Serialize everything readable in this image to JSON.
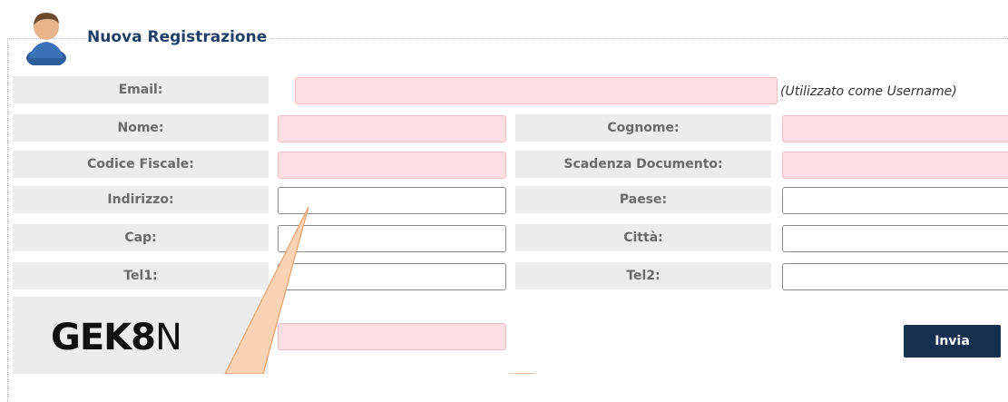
{
  "header": {
    "title": "Nuova Registrazione"
  },
  "form": {
    "email_label": "Email:",
    "email_note": "(Utilizzato come Username)",
    "nome_label": "Nome:",
    "cognome_label": "Cognome:",
    "codice_fiscale_label": "Codice Fiscale:",
    "scadenza_documento_label": "Scadenza Documento:",
    "indirizzo_label": "Indirizzo:",
    "paese_label": "Paese:",
    "cap_label": "Cap:",
    "citta_label": "Città:",
    "tel1_label": "Tel1:",
    "tel2_label": "Tel2:",
    "captcha_text_main": "GEK8",
    "captcha_text_last": "N",
    "submit_label": "Invia"
  },
  "colors": {
    "required_fill": "#fddfe3",
    "label_background": "#ececec",
    "button": "#17304f",
    "title": "#1f3f66",
    "callout_fill": "#fbd3b4"
  },
  "icons": {
    "avatar": "user-avatar-icon"
  }
}
